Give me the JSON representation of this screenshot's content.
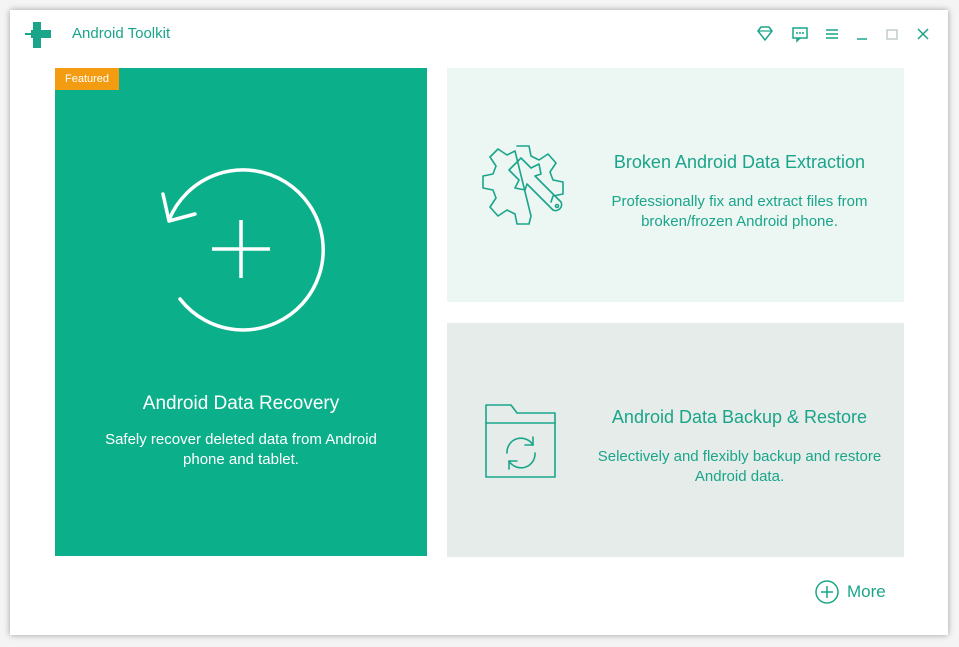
{
  "window": {
    "title": "Android Toolkit"
  },
  "titlebar": {
    "buttons": [
      "diamond-icon",
      "feedback-icon",
      "menu-icon",
      "minimize-icon",
      "maximize-icon",
      "close-icon"
    ]
  },
  "colors": {
    "accent": "#1aa58a",
    "featured_bg": "#0bb08b",
    "badge": "#f39c12",
    "card_light": "#ecf6f3",
    "card_gray": "#e5ece9"
  },
  "featured": {
    "badge": "Featured",
    "title": "Android Data Recovery",
    "description": "Safely recover deleted data from Android phone and tablet.",
    "icon": "recovery-icon"
  },
  "cards": [
    {
      "title": "Broken Android Data Extraction",
      "description": "Professionally fix and extract files from broken/frozen Android phone.",
      "icon": "gear-wrench-icon"
    },
    {
      "title": "Android Data Backup & Restore",
      "description": "Selectively and flexibly backup and restore Android data.",
      "icon": "folder-sync-icon"
    }
  ],
  "more": {
    "label": "More",
    "icon": "plus-circle-icon"
  }
}
